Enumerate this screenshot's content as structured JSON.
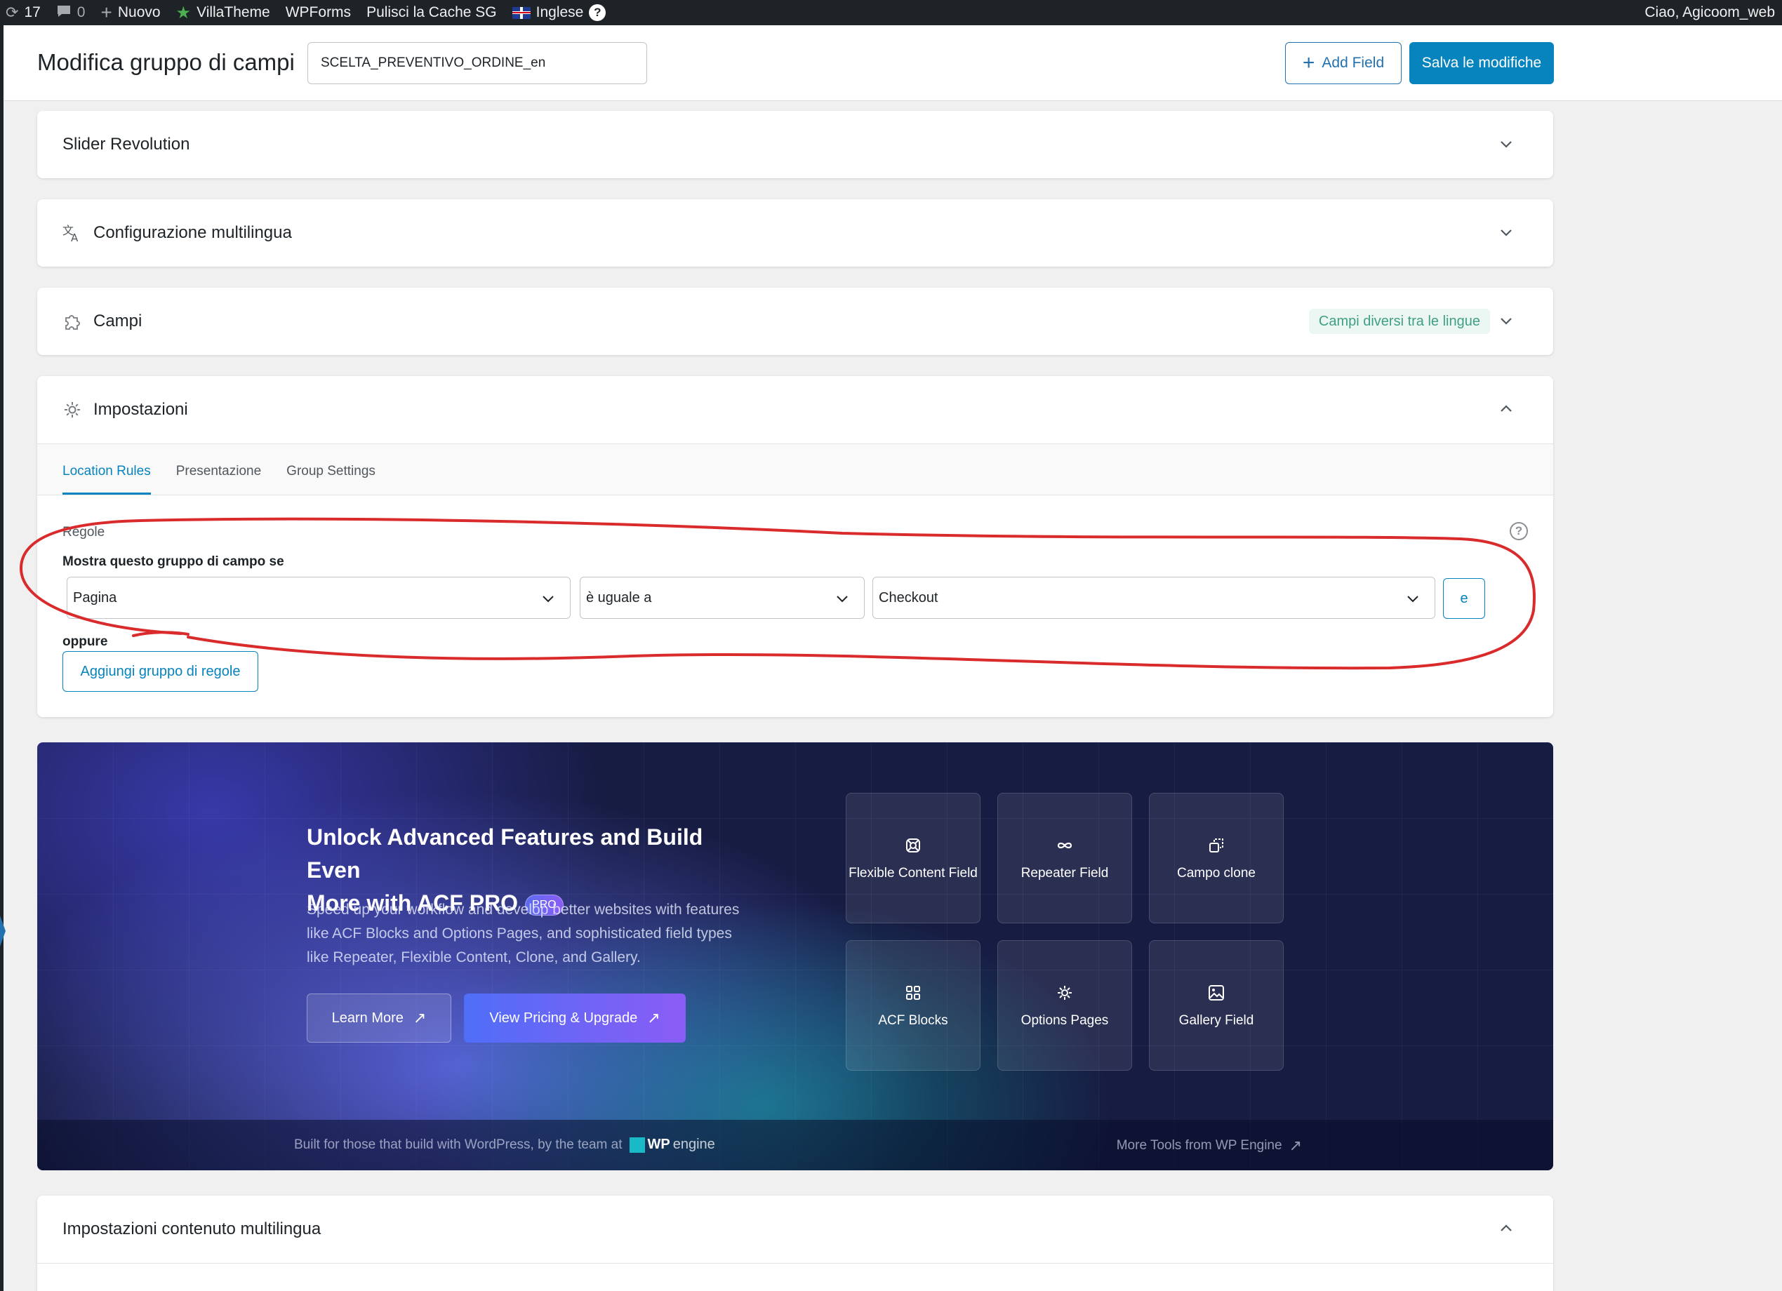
{
  "adminbar": {
    "updates_count": "17",
    "comments_count": "0",
    "new_label": "Nuovo",
    "villatheme_label": "VillaTheme",
    "wpforms_label": "WPForms",
    "cache_label": "Pulisci la Cache SG",
    "language_label": "Inglese",
    "greeting": "Ciao, Agicoom_web"
  },
  "header": {
    "title": "Modifica gruppo di campi",
    "group_name_value": "SCELTA_PREVENTIVO_ORDINE_en",
    "add_field_label": "Add Field",
    "save_label": "Salva le modifiche"
  },
  "panels": {
    "slider": {
      "title": "Slider Revolution"
    },
    "multilang": {
      "title": "Configurazione multilingua"
    },
    "fields": {
      "title": "Campi",
      "badge": "Campi diversi tra le lingue"
    },
    "settings": {
      "title": "Impostazioni",
      "tabs": [
        "Location Rules",
        "Presentazione",
        "Group Settings"
      ],
      "rules_label": "Regole",
      "show_if_label": "Mostra questo gruppo di campo se",
      "param_value": "Pagina",
      "operator_value": "è uguale a",
      "value_value": "Checkout",
      "and_label": "e",
      "or_label": "oppure",
      "add_group_label": "Aggiungi gruppo di regole"
    },
    "content_multilang": {
      "title": "Impostazioni contenuto multilingua"
    }
  },
  "promo": {
    "title_line1": "Unlock Advanced Features and Build Even",
    "title_line2": "More with ACF PRO",
    "pro_badge": "PRO",
    "description": "Speed up your workflow and develop better websites with features like ACF Blocks and Options Pages, and sophisticated field types like Repeater, Flexible Content, Clone, and Gallery.",
    "learn_more_label": "Learn More",
    "upgrade_label": "View Pricing & Upgrade",
    "features": [
      {
        "label": "Flexible Content Field",
        "icon": "flexible-content-icon"
      },
      {
        "label": "Repeater Field",
        "icon": "infinity-icon"
      },
      {
        "label": "Campo clone",
        "icon": "clone-icon"
      },
      {
        "label": "ACF Blocks",
        "icon": "blocks-grid-icon"
      },
      {
        "label": "Options Pages",
        "icon": "gear-icon"
      },
      {
        "label": "Gallery Field",
        "icon": "image-icon"
      }
    ],
    "footer_text": "Built for those that build with WordPress, by the team at",
    "footer_logo_bold": "WP",
    "footer_logo_light": "engine",
    "footer_right": "More Tools from WP Engine"
  },
  "colors": {
    "primary": "#0783be",
    "admin_bar": "#1d2327",
    "badge_bg": "#ecf7f3",
    "badge_text": "#3f9f84",
    "annotation": "#d92b2b"
  }
}
